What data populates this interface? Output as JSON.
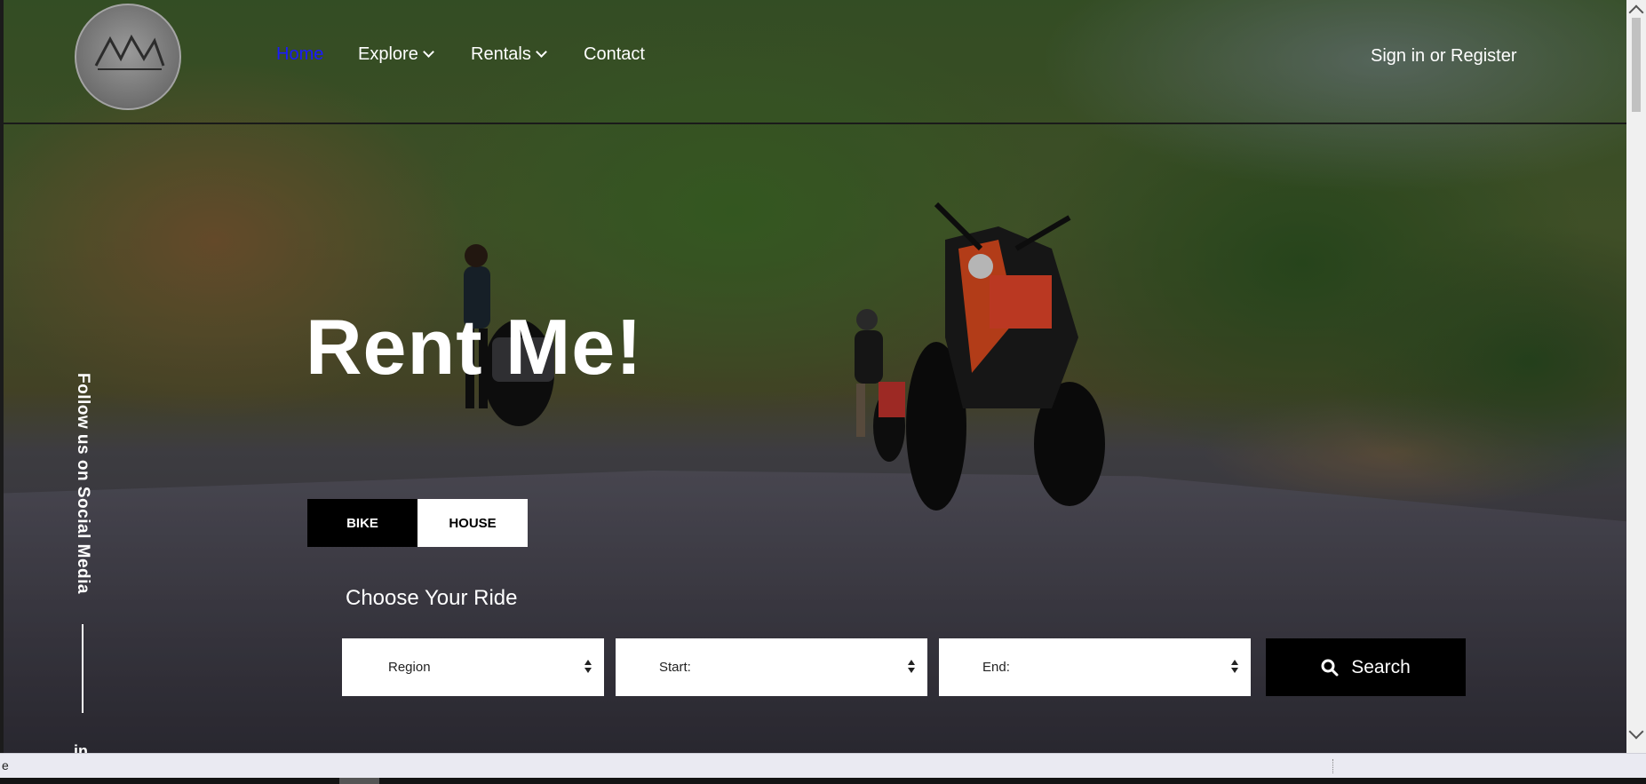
{
  "nav": {
    "items": [
      {
        "label": "Home",
        "active": true
      },
      {
        "label": "Explore",
        "dropdown": true
      },
      {
        "label": "Rentals",
        "dropdown": true
      },
      {
        "label": "Contact"
      }
    ],
    "signin": "Sign in or Register"
  },
  "side": {
    "social_label": "Follow us on Social Media",
    "linkedin": "in"
  },
  "hero": {
    "title": "Rent Me!",
    "tabs": [
      {
        "label": "BIKE",
        "active": true
      },
      {
        "label": "HOUSE",
        "active": false
      }
    ],
    "subtitle": "Choose Your Ride",
    "fields": [
      {
        "value": "Region"
      },
      {
        "value": "Start:"
      },
      {
        "value": "End:"
      }
    ],
    "search_label": "Search"
  },
  "status": {
    "text": "e"
  },
  "colors": {
    "active_nav": "#1a1aff",
    "tab_active_bg": "#000000",
    "search_bg": "#000000"
  }
}
